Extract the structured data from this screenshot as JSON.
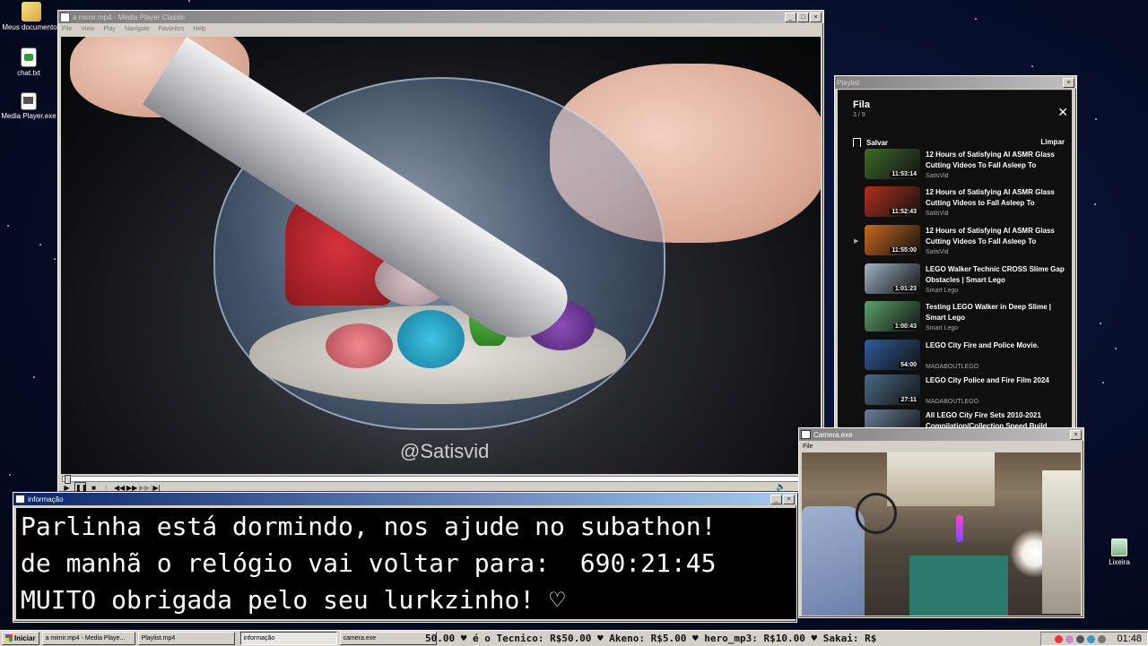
{
  "desktop": {
    "icons": [
      {
        "label": "Meus documentos",
        "icon": "folder-icon"
      },
      {
        "label": "chat.txt",
        "icon": "text-file-icon"
      },
      {
        "label": "Media Player.exe",
        "icon": "media-player-icon"
      }
    ],
    "trash_label": "Lixeira"
  },
  "media_player": {
    "title": "a mimir.mp4 - Media Player Classic",
    "menu": [
      "File",
      "View",
      "Play",
      "Navigate",
      "Favorites",
      "Help"
    ],
    "watermark": "@Satisvid"
  },
  "playlist_window": {
    "title": "Playlist",
    "header": "Fila",
    "count": "3 / 9",
    "save_label": "Salvar",
    "clear_label": "Limpar",
    "items": [
      {
        "title": "12 Hours of Satisfying AI ASMR Glass Cutting Videos To Fall Asleep To",
        "channel": "SatisVid",
        "duration": "11:53:14",
        "color": "#3d6b2a"
      },
      {
        "title": "12 Hours of Satisfying AI ASMR Glass Cutting Videos to Fall Asleep To",
        "channel": "SatisVid",
        "duration": "11:52:43",
        "color": "#b0311c"
      },
      {
        "title": "12 Hours of Satisfying AI ASMR Glass Cutting Videos To Fall Asleep To",
        "channel": "SatisVid",
        "duration": "11:55:00",
        "color": "#c96a1e",
        "playing": true
      },
      {
        "title": "LEGO Walker Technic CROSS Slime Gap Obstacles | Smart Lego",
        "channel": "Smart Lego",
        "duration": "1:01:23",
        "color": "#9fb3c2"
      },
      {
        "title": "Testing LEGO Walker in Deep Slime | Smart Lego",
        "channel": "Smart Lego",
        "duration": "1:00:43",
        "color": "#5ca36b"
      },
      {
        "title": "LEGO City Fire and Police Movie.",
        "channel": "MADABOUTLEGO",
        "duration": "54:00",
        "color": "#2f5c9c"
      },
      {
        "title": "LEGO City Police and Fire Film 2024",
        "channel": "MADABOUTLEGO",
        "duration": "27:11",
        "color": "#4a6b85"
      },
      {
        "title": "All LEGO City Fire Sets 2010-2021 Compilation/Collection Speed Build",
        "channel": "",
        "duration": "",
        "color": "#6b7f9a"
      }
    ]
  },
  "camera_window": {
    "title": "Camera.exe",
    "menu": "File"
  },
  "info_window": {
    "title": "informação",
    "lines": [
      "Parlinha está dormindo, nos ajude no subathon!",
      "de manhã o relógio vai voltar para:  690:21:45",
      "MUITO obrigada pelo seu lurkzinho! ♡"
    ]
  },
  "taskbar": {
    "start": "Iniciar",
    "tasks": [
      "a mimir.mp4 - Media Playe...",
      "Playlist.mp4",
      "informação",
      "camera.exe"
    ],
    "ticker": "50.00 ♥ é o Tecnico: R$50.00 ♥ Akeno: R$5.00 ♥ hero_mp3: R$10.00 ♥ Sakai: R$",
    "clock": "01:48"
  }
}
